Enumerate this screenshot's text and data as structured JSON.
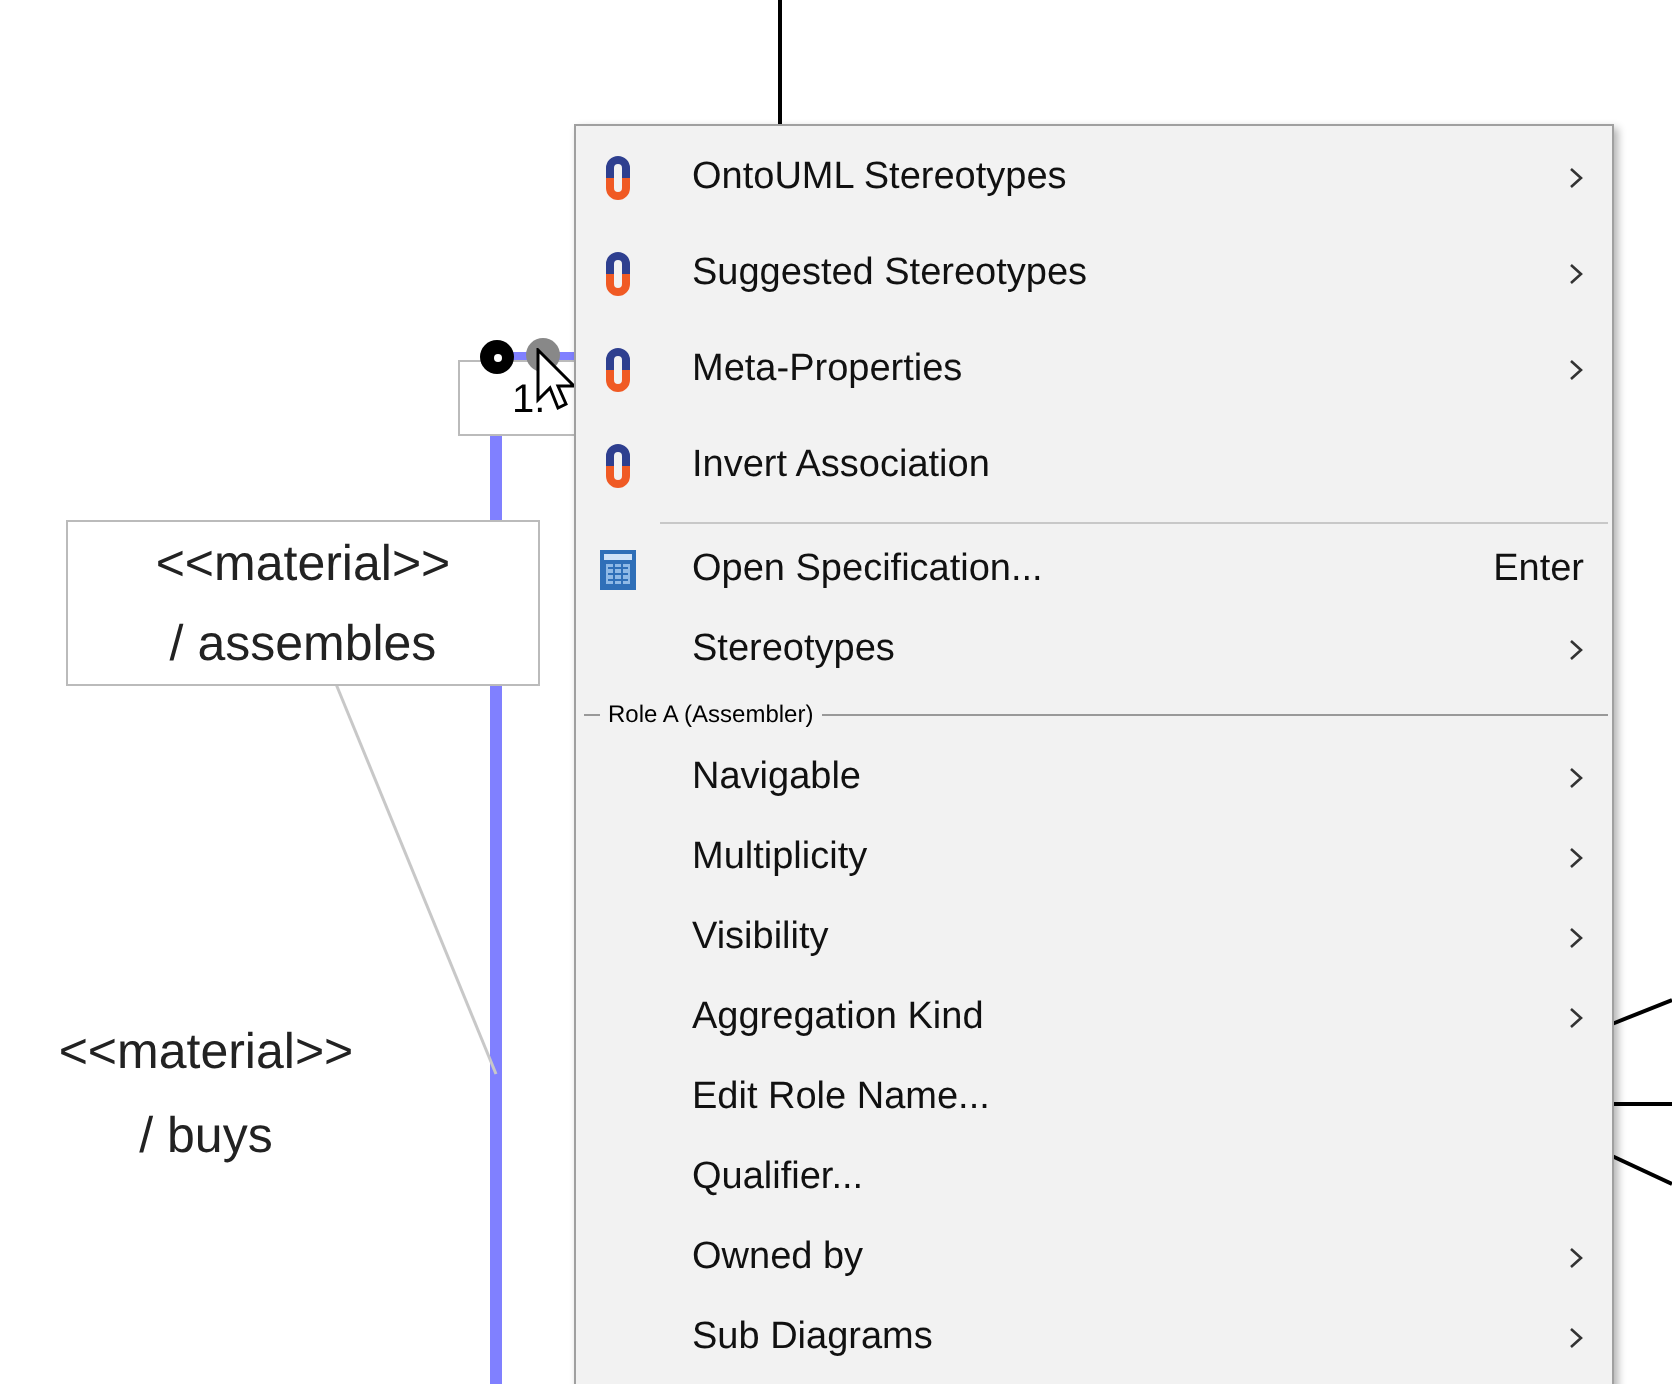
{
  "diagram": {
    "multiplicity": "1.",
    "labels": [
      {
        "stereotype": "<<material>>",
        "name": "/ assembles",
        "boxed": true
      },
      {
        "stereotype": "<<material>>",
        "name": "/ buys",
        "boxed": false
      }
    ]
  },
  "context_menu": {
    "items": [
      {
        "kind": "ontouml",
        "label": "OntoUML Stereotypes",
        "submenu": true
      },
      {
        "kind": "ontouml",
        "label": "Suggested Stereotypes",
        "submenu": true
      },
      {
        "kind": "ontouml",
        "label": "Meta-Properties",
        "submenu": true
      },
      {
        "kind": "ontouml",
        "label": "Invert Association",
        "submenu": false
      },
      {
        "kind": "separator"
      },
      {
        "kind": "spec",
        "label": "Open Specification...",
        "shortcut": "Enter",
        "submenu": false
      },
      {
        "kind": "item",
        "label": "Stereotypes",
        "submenu": true
      },
      {
        "kind": "group",
        "label": "Role A (Assembler)"
      },
      {
        "kind": "item",
        "label": "Navigable",
        "submenu": true
      },
      {
        "kind": "item",
        "label": "Multiplicity",
        "submenu": true
      },
      {
        "kind": "item",
        "label": "Visibility",
        "submenu": true
      },
      {
        "kind": "item",
        "label": "Aggregation Kind",
        "submenu": true
      },
      {
        "kind": "item",
        "label": "Edit Role Name...",
        "submenu": false
      },
      {
        "kind": "item",
        "label": "Qualifier...",
        "submenu": false
      },
      {
        "kind": "item",
        "label": "Owned by",
        "submenu": true
      },
      {
        "kind": "item",
        "label": "Sub Diagrams",
        "submenu": true
      }
    ]
  }
}
